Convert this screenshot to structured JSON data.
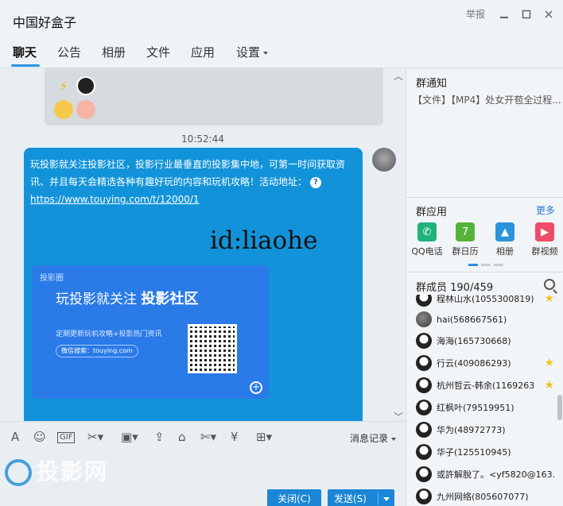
{
  "window": {
    "title": "中国好盒子",
    "report_label": "举报"
  },
  "tabs": [
    {
      "label": "聊天"
    },
    {
      "label": "公告"
    },
    {
      "label": "相册"
    },
    {
      "label": "文件"
    },
    {
      "label": "应用"
    },
    {
      "label": "设置"
    }
  ],
  "chat": {
    "timestamp": "10:52:44",
    "message": {
      "text": "玩投影就关注投影社区，投影行业最垂直的投影集中地，可第一时间获取资讯、并且每天会精选各种有趣好玩的内容和玩机攻略！活动地址：",
      "link": "https://www.touying.com/t/12000/1",
      "watermark_id": "id:liaohe"
    },
    "card": {
      "logo": "投影圈",
      "title_prefix": "玩投影就关注",
      "title_bold": "投影社区",
      "subtitle": "定期更新玩机攻略+投影热门资讯",
      "site": "微信搜索：touying.com"
    }
  },
  "toolbar": {
    "message_record_label": "消息记录"
  },
  "bottom": {
    "watermark_brand": "投影网",
    "close_label": "关闭(C)",
    "send_label": "发送(S)"
  },
  "right_panel": {
    "notice_title": "群通知",
    "notice_text": "【文件】【MP4】处女开苞全过程...",
    "apps_title": "群应用",
    "more_label": "更多",
    "apps": [
      {
        "label": "QQ电话",
        "icon": "phone-icon",
        "color": "#1fb37a"
      },
      {
        "label": "群日历",
        "icon": "calendar-icon",
        "color": "#56b33a"
      },
      {
        "label": "相册",
        "icon": "photo-icon",
        "color": "#2a93d9"
      },
      {
        "label": "群视频",
        "icon": "video-icon",
        "color": "#ef4c6b"
      }
    ],
    "members_title": "群成员 190/459",
    "members": [
      {
        "name": "程林山水(1055300819)",
        "star": true,
        "avatar": "penguin"
      },
      {
        "name": "hai(568667561)",
        "star": false,
        "avatar": "photo"
      },
      {
        "name": "海海(165730668)",
        "star": false,
        "avatar": "penguin"
      },
      {
        "name": "行云(409086293)",
        "star": true,
        "avatar": "penguin"
      },
      {
        "name": "杭州哲云-韩余(1169263",
        "star": true,
        "avatar": "penguin"
      },
      {
        "name": "红枫叶(79519951)",
        "star": false,
        "avatar": "penguin"
      },
      {
        "name": "华为(48972773)",
        "star": false,
        "avatar": "penguin"
      },
      {
        "name": "华子(125510945)",
        "star": false,
        "avatar": "penguin"
      },
      {
        "name": "或許解脫了。<yf5820@163.",
        "star": false,
        "avatar": "penguin"
      },
      {
        "name": "九州网络(805607077)",
        "star": false,
        "avatar": "penguin"
      }
    ]
  }
}
